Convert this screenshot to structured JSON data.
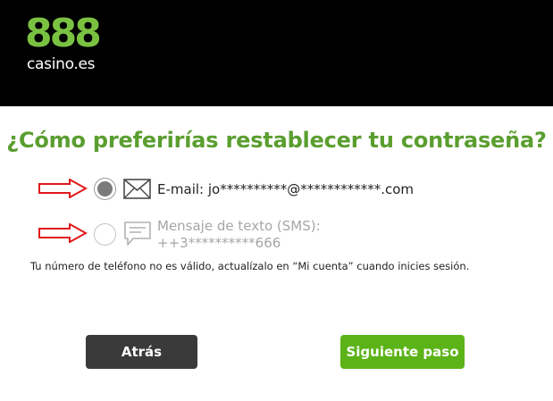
{
  "header": {
    "logo_number": "888",
    "logo_subtitle": "casino.es",
    "background": "#000000",
    "logo_color": "#7ac142"
  },
  "title": "¿Cómo preferirías restablecer tu contraseña?",
  "options": [
    {
      "label": "E-mail: jo**********@************.com",
      "icon": "envelope-icon",
      "selected": true,
      "enabled": true
    },
    {
      "label_line1": "Mensaje de texto (SMS):",
      "label_line2": "++3**********666",
      "icon": "sms-chat-icon",
      "selected": false,
      "enabled": false
    }
  ],
  "note": "Tu número de teléfono no es válido, actualízalo en “Mi cuenta” cuando inicies sesión.",
  "buttons": {
    "back_label": "Atrás",
    "next_label": "Siguiente paso"
  },
  "colors": {
    "accent_green": "#5a9e2f",
    "next_button": "#5cb318",
    "back_button": "#3a3a3a",
    "annotation_arrow": "#e0191b"
  }
}
